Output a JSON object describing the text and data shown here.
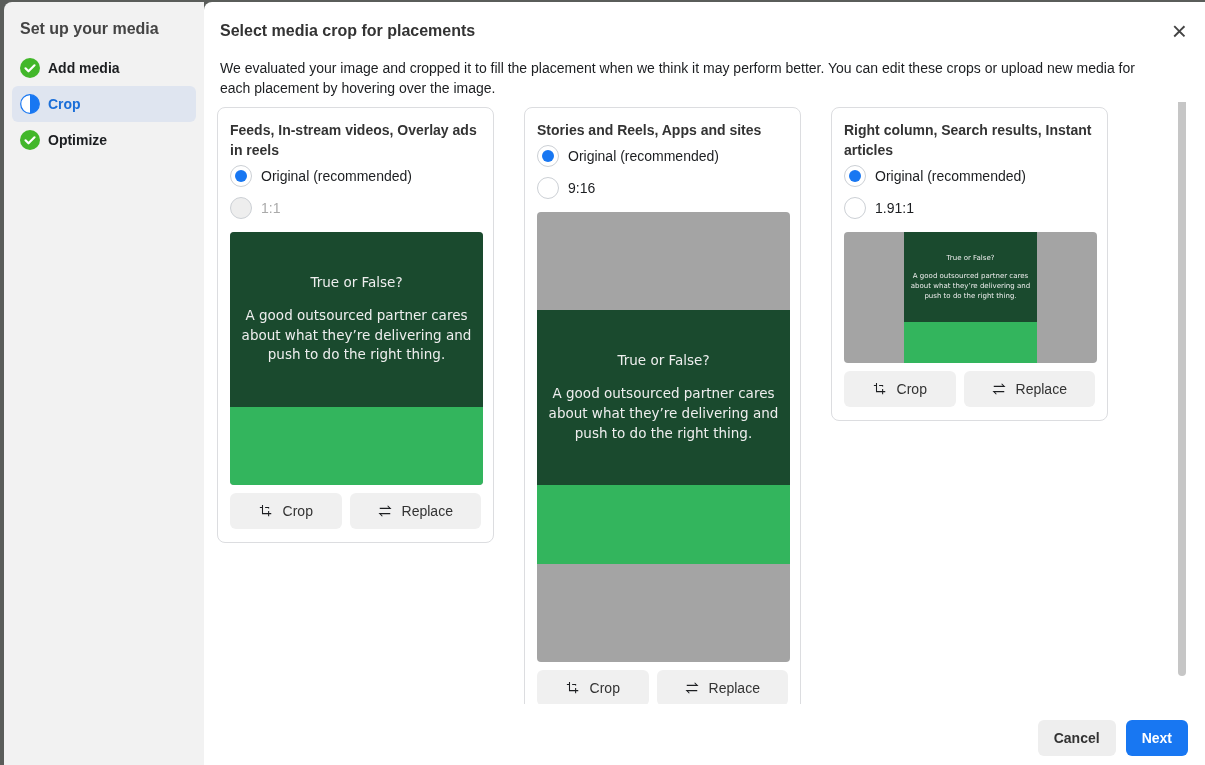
{
  "sidebar": {
    "title": "Set up your media",
    "steps": [
      {
        "label": "Add media",
        "kind": "done",
        "selected": false
      },
      {
        "label": "Crop",
        "kind": "current",
        "selected": true
      },
      {
        "label": "Optimize",
        "kind": "done",
        "selected": false
      }
    ]
  },
  "dialog": {
    "title": "Select media crop for placements",
    "close": "×",
    "description": "We evaluated your image and cropped it to fill the placement when we think it may perform better. You can edit these crops or upload new media for each placement by hovering over the image."
  },
  "placements": [
    {
      "title": "Feeds, In-stream videos, Overlay ads in reels",
      "options": [
        {
          "label": "Original (recommended)",
          "selected": true,
          "disabled": false
        },
        {
          "label": "1:1",
          "selected": false,
          "disabled": true
        }
      ],
      "media": {
        "kind": "square",
        "headline": "True or False?",
        "body": "A good outsourced partner cares about what they’re delivering and push to do the right thing."
      },
      "crop_button": "Crop",
      "replace_button": "Replace"
    },
    {
      "title": "Stories and Reels, Apps and sites",
      "options": [
        {
          "label": "Original (recommended)",
          "selected": true,
          "disabled": false
        },
        {
          "label": "9:16",
          "selected": false,
          "disabled": false
        }
      ],
      "media": {
        "kind": "tall",
        "headline": "True or False?",
        "body": "A good outsourced partner cares about what they’re delivering and push to do the right thing."
      },
      "crop_button": "Crop",
      "replace_button": "Replace"
    },
    {
      "title": "Right column, Search results, Instant articles",
      "options": [
        {
          "label": "Original (recommended)",
          "selected": true,
          "disabled": false
        },
        {
          "label": "1.91:1",
          "selected": false,
          "disabled": false
        }
      ],
      "media": {
        "kind": "wide",
        "headline": "True or False?",
        "body": "A good outsourced partner cares about what they’re delivering and push to do the right thing."
      },
      "crop_button": "Crop",
      "replace_button": "Replace"
    }
  ],
  "footer": {
    "cancel": "Cancel",
    "next": "Next"
  }
}
